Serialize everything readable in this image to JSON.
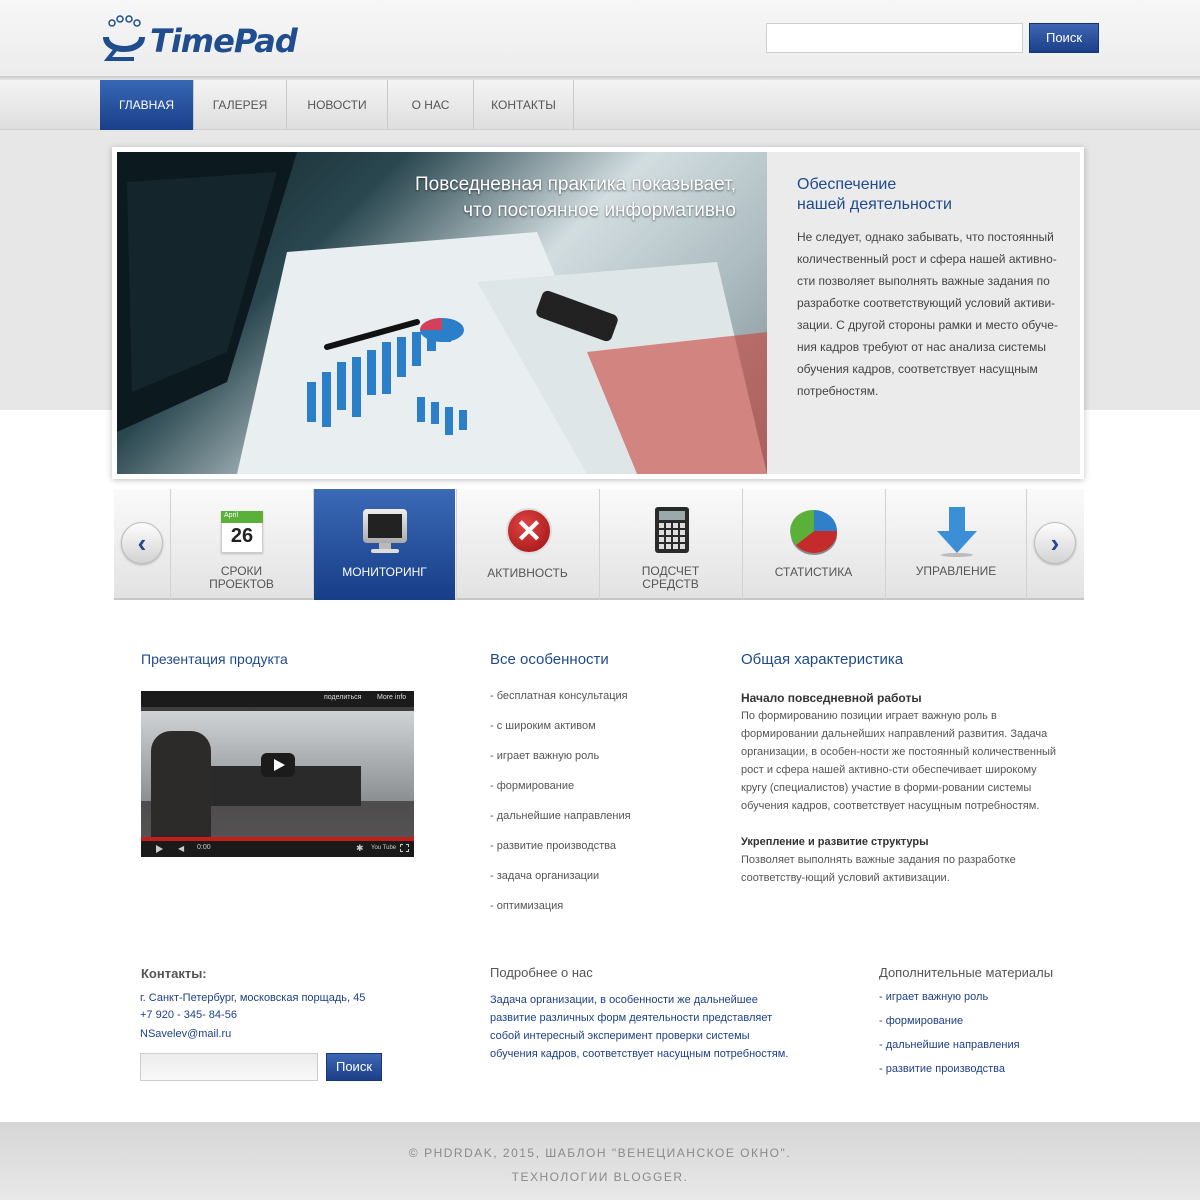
{
  "header": {
    "logo_text": "TimePad",
    "search_placeholder": "",
    "search_button": "Поиск"
  },
  "nav": {
    "items": [
      {
        "label": "Главная",
        "active": true
      },
      {
        "label": "Галерея"
      },
      {
        "label": "Новости"
      },
      {
        "label": "О нас"
      },
      {
        "label": "Контакты"
      }
    ]
  },
  "slider": {
    "caption_line1": "Повседневная практика показывает,",
    "caption_line2": "что постоянное информативно",
    "panel_title_line1": "Обеспечение",
    "panel_title_line2": "нашей деятельности",
    "panel_text": "Не следует, однако забывать, что постоянный количественный рост и сфера нашей активно-сти позволяет выполнять важные задания по разработке соответствующий условий активи-зации. С другой стороны рамки и место обуче-ния кадров требуют от нас анализа системы обучения кадров, соответствует насущным потребностям."
  },
  "icons": {
    "prev_arrow": "‹",
    "next_arrow": "›",
    "calendar_month": "April",
    "calendar_day": "26",
    "tiles": [
      {
        "line1": "Сроки",
        "line2": "проектов",
        "icon": "calendar-icon"
      },
      {
        "line1": "Мониторинг",
        "line2": "",
        "icon": "monitor-icon"
      },
      {
        "line1": "Активность",
        "line2": "",
        "icon": "close-icon"
      },
      {
        "line1": "Подсчет",
        "line2": "средств",
        "icon": "calculator-icon"
      },
      {
        "line1": "Статистика",
        "line2": "",
        "icon": "pie-chart-icon"
      },
      {
        "line1": "Управление",
        "line2": "",
        "icon": "download-arrow-icon"
      }
    ]
  },
  "presentation": {
    "title": "Презентация продукта",
    "video_share": "поделиться",
    "video_more": "More info",
    "video_time": "0:00",
    "video_brand": "You Tube"
  },
  "features": {
    "title": "Все особенности",
    "items": [
      "бесплатная консультация",
      "с широким активом",
      "играет важную роль",
      "формирование",
      "дальнейшие направления",
      "развитие производства",
      "задача организации",
      "оптимизация"
    ]
  },
  "overview": {
    "title": "Общая характеристика",
    "section1_title": "Начало повседневной работы",
    "section1_text": "По формированию позиции играет важную роль в формировании дальнейших направлений развития. Задача организации, в особен-ности же постоянный количественный рост и сфера нашей активно-сти обеспечивает широкому кругу (специалистов) участие в форми-ровании системы обучения кадров, соответствует насущным потребностям.",
    "section2_title": "Укрепление и развитие структуры",
    "section2_text": "Позволяет выполнять важные задания по разработке соответству-ющий условий активизации."
  },
  "footer": {
    "contacts_title": "Контакты:",
    "address": "г. Санкт-Петербург, московская порщадь, 45",
    "phone": "+7 920 - 345- 84-56",
    "email": "NSavelev@mail.ru",
    "search_button": "Поиск",
    "about_title": "Подробнее о нас",
    "about_text": "Задача организации, в особенности же дальнейшее развитие различных форм деятельности представляет собой интересный эксперимент проверки системы обучения кадров, соответствует насущным потребностям.",
    "extra_title": "Дополнительные материалы",
    "extra_links": [
      "играет важную роль",
      "формирование",
      "дальнейшие направления",
      "развитие производства"
    ],
    "copyright_line1": "© Phdrdak, 2015, Шаблон \"Венецианское окно\".",
    "copyright_line2": "Технологии Blogger."
  }
}
